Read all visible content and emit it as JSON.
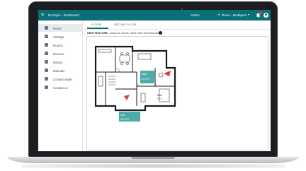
{
  "app": {
    "title": "EcoSync - Dashboard",
    "selector_left": "Admin",
    "selector_right": "Demo - Budapest"
  },
  "sidebar": {
    "items": [
      {
        "label": "Home",
        "icon": "home-icon",
        "active": true
      },
      {
        "label": "Settings",
        "icon": "settings-icon"
      },
      {
        "label": "Rooms",
        "icon": "rooms-icon"
      },
      {
        "label": "Devices",
        "icon": "devices-icon"
      },
      {
        "label": "History",
        "icon": "history-icon"
      },
      {
        "label": "Manuals",
        "icon": "manuals-icon"
      },
      {
        "label": "Contact Mode",
        "icon": "contact-mode-icon"
      },
      {
        "label": "Contact us",
        "icon": "mail-icon"
      }
    ]
  },
  "tabs": [
    {
      "label": "FLOOR",
      "active": true
    },
    {
      "label": "SECOND FLOOR",
      "active": false
    }
  ],
  "notice": {
    "prefix": "NEW FEATURE:",
    "text": "Zoom on Scroll. Click here for learn info"
  },
  "floorplan": {
    "rooms": [
      {
        "label": "Main",
        "value": "22.5°C"
      },
      {
        "label": "Bath",
        "value": "21°C"
      },
      {
        "label": "Hall",
        "value": "20.0°C"
      }
    ]
  },
  "colors": {
    "topbar": "#0b6f78",
    "room_highlight": "#3aa39d",
    "alert": "#e53935"
  }
}
